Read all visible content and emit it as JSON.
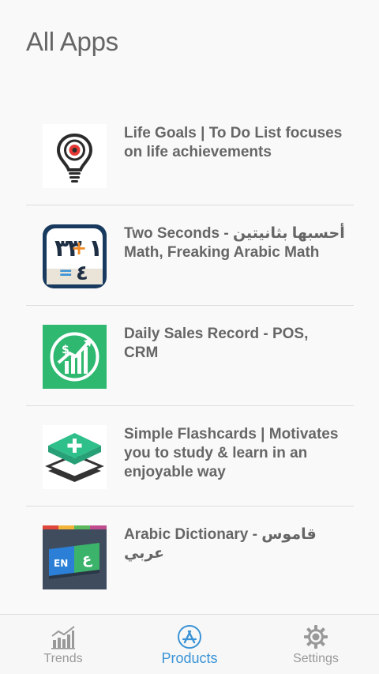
{
  "header": {
    "title": "All Apps"
  },
  "apps": [
    {
      "title": "Life Goals | To Do List focuses on life achievements",
      "icon": "lightbulb-target-icon"
    },
    {
      "title": "Two Seconds - أحسبها بثانيتين Math, Freaking Arabic Math",
      "icon": "arabic-math-icon"
    },
    {
      "title": "Daily Sales Record - POS, CRM",
      "icon": "sales-chart-icon"
    },
    {
      "title": "Simple Flashcards | Motivates you to study & learn in an enjoyable way",
      "icon": "flashcards-stack-icon"
    },
    {
      "title": "Arabic Dictionary - قاموس عربي",
      "icon": "book-en-ar-icon"
    }
  ],
  "tabs": [
    {
      "label": "Trends",
      "icon": "trends-chart-icon",
      "active": false
    },
    {
      "label": "Products",
      "icon": "app-store-icon",
      "active": true
    },
    {
      "label": "Settings",
      "icon": "gear-icon",
      "active": false
    }
  ],
  "colors": {
    "accent": "#3a93d6",
    "inactive": "#999999",
    "text": "#666666",
    "sales_green": "#2eb870",
    "flashcard_green": "#2fbf8a",
    "math_navy": "#173a5e"
  }
}
